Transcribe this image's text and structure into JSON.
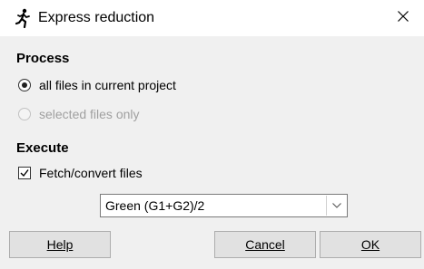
{
  "window": {
    "title": "Express reduction"
  },
  "process": {
    "title": "Process",
    "options": [
      {
        "label": "all files in current project",
        "selected": true,
        "enabled": true
      },
      {
        "label": "selected files only",
        "selected": false,
        "enabled": false
      }
    ]
  },
  "execute": {
    "title": "Execute",
    "fetch_convert": {
      "label": "Fetch/convert files",
      "checked": true
    },
    "mode_select": {
      "value": "Green (G1+G2)/2"
    }
  },
  "buttons": {
    "help": "Help",
    "cancel": "Cancel",
    "ok": "OK"
  },
  "icons": {
    "app": "running-person-icon",
    "close": "close-icon",
    "dropdown": "chevron-down-icon",
    "check": "checkmark-icon"
  }
}
